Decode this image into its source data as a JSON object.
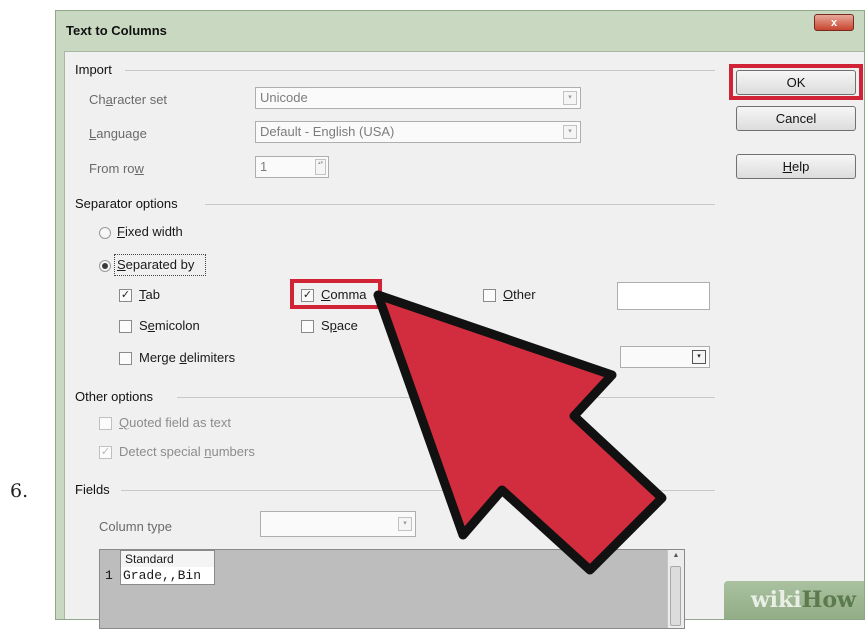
{
  "step_number": "6.",
  "window": {
    "title": "Text to Columns",
    "close_glyph": "x"
  },
  "import": {
    "section_title": "Import",
    "character_set": {
      "label_pre": "Ch",
      "label_u": "a",
      "label_post": "racter set",
      "value": "Unicode"
    },
    "language": {
      "label_pre": "",
      "label_u": "L",
      "label_post": "anguage",
      "value": "Default - English (USA)"
    },
    "from_row": {
      "label_pre": "From ro",
      "label_u": "w",
      "label_post": "",
      "value": "1"
    }
  },
  "separator_options": {
    "section_title": "Separator options",
    "fixed_width": {
      "label_pre": "",
      "label_u": "F",
      "label_post": "ixed width",
      "selected": false
    },
    "separated_by": {
      "label_pre": "",
      "label_u": "S",
      "label_post": "eparated by",
      "selected": true
    },
    "tab": {
      "label_pre": "",
      "label_u": "T",
      "label_post": "ab",
      "checked": true
    },
    "comma": {
      "label_pre": "",
      "label_u": "C",
      "label_post": "omma",
      "checked": true
    },
    "other": {
      "label_pre": "",
      "label_u": "O",
      "label_post": "ther",
      "checked": false,
      "value": ""
    },
    "semicolon": {
      "label_pre": "S",
      "label_u": "e",
      "label_post": "micolon",
      "checked": false
    },
    "space": {
      "label_pre": "S",
      "label_u": "p",
      "label_post": "ace",
      "checked": false
    },
    "merge_delimiters": {
      "label_pre": "Merge ",
      "label_u": "d",
      "label_post": "elimiters",
      "checked": false
    },
    "check_glyph": "✓"
  },
  "other_options": {
    "section_title": "Other options",
    "quoted_field": {
      "label_pre": "",
      "label_u": "Q",
      "label_post": "uoted field as text",
      "checked": false
    },
    "detect_special": {
      "label_pre": "Detect special ",
      "label_u": "n",
      "label_post": "umbers",
      "checked": true
    }
  },
  "fields": {
    "section_title": "Fields",
    "column_type_label": "Column type",
    "column_type_value": "",
    "preview": {
      "column_header": "Standard",
      "row_number": "1",
      "row_text": "Grade,,Bin"
    }
  },
  "buttons": {
    "ok": "OK",
    "cancel": "Cancel",
    "help_u": "H",
    "help_post": "elp"
  },
  "watermark": {
    "part1": "wiki",
    "part2": "How"
  },
  "colors": {
    "highlight": "#d02335",
    "arrow_fill": "#d22d3e",
    "arrow_stroke": "#111111",
    "window_frame": "#c9d9c1",
    "dialog_bg": "#f0f0f0"
  },
  "icons": {
    "dropdown": "chevron-down-icon",
    "spin": "spin-arrows-icon",
    "pointer": "red-arrow-icon"
  },
  "arrow_glyph": "▾",
  "spin_glyph": "▴▾"
}
